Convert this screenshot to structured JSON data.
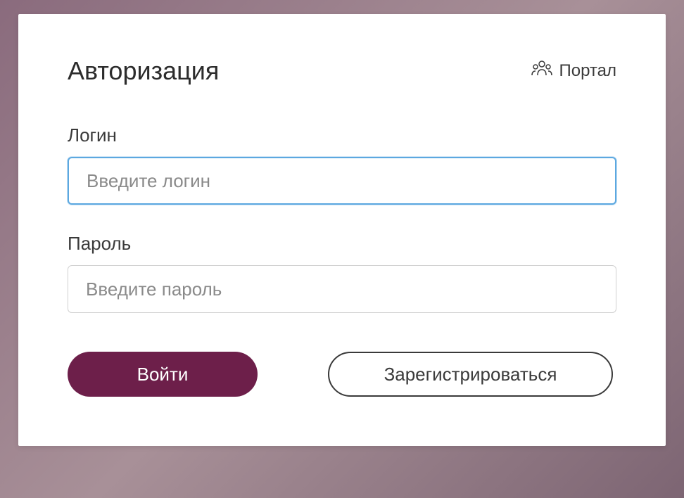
{
  "header": {
    "title": "Авторизация",
    "portal_label": "Портал"
  },
  "fields": {
    "login": {
      "label": "Логин",
      "placeholder": "Введите логин",
      "value": ""
    },
    "password": {
      "label": "Пароль",
      "placeholder": "Введите пароль",
      "value": ""
    }
  },
  "buttons": {
    "submit": "Войти",
    "register": "Зарегистрироваться"
  },
  "colors": {
    "accent": "#6d1f4a",
    "focus_border": "#5ca8e0",
    "text": "#3a3a3a"
  }
}
